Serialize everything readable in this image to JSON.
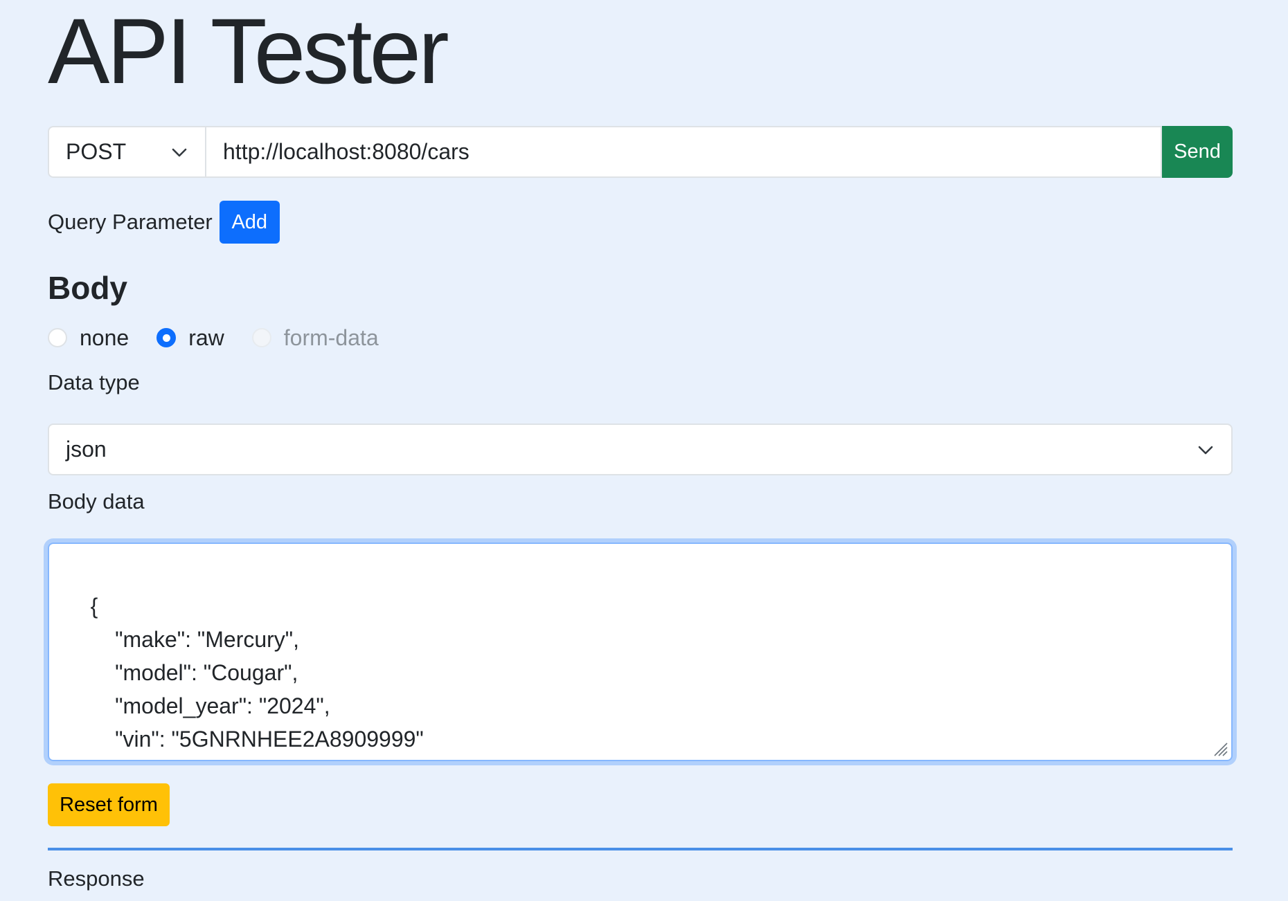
{
  "app": {
    "title": "API Tester"
  },
  "request": {
    "method": "POST",
    "url": "http://localhost:8080/cars",
    "send_label": "Send"
  },
  "query": {
    "label": "Query Parameter",
    "add_label": "Add"
  },
  "body_section": {
    "heading": "Body",
    "options": [
      {
        "label": "none",
        "checked": false,
        "disabled": false
      },
      {
        "label": "raw",
        "checked": true,
        "disabled": false
      },
      {
        "label": "form-data",
        "checked": false,
        "disabled": true
      }
    ],
    "data_type_label": "Data type",
    "data_type_value": "json",
    "body_data_label": "Body data",
    "body_data_value": "{\n        \"make\": \"Mercury\",\n        \"model\": \"Cougar\",\n        \"model_year\": \"2024\",\n        \"vin\": \"5GNRNHEE2A8909999\"\n    }"
  },
  "actions": {
    "reset_label": "Reset form"
  },
  "response": {
    "label": "Response"
  },
  "colors": {
    "background": "#e9f1fc",
    "send": "#198754",
    "add": "#0d6efd",
    "reset": "#ffc107",
    "divider": "#4a8fe7"
  },
  "icons": {
    "method_dropdown": "chevron-down-icon",
    "datatype_dropdown": "chevron-down-icon",
    "textarea_resize": "resize-grip-icon"
  }
}
